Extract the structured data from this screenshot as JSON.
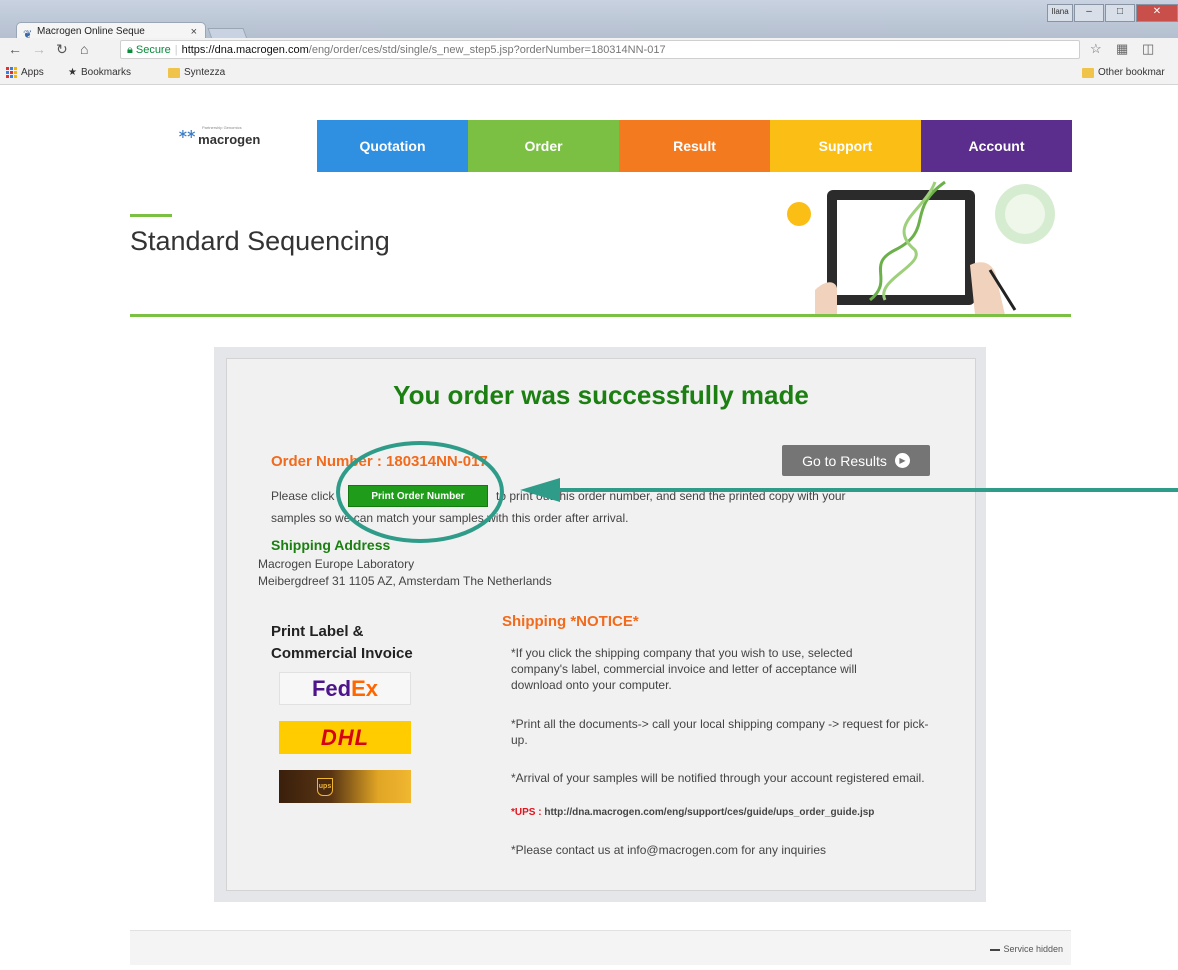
{
  "browser": {
    "tab_title": "Macrogen Online Seque",
    "tab_close": "×",
    "url_secure": "Secure",
    "url_host": "https://dna.macrogen.com",
    "url_path": "/eng/order/ces/std/single/s_new_step5.jsp?orderNumber=180314NN-017",
    "user_label": "Ilana",
    "bookmarks": {
      "apps": "Apps",
      "bookmarks": "Bookmarks",
      "syntezza": "Syntezza",
      "other": "Other bookmar"
    }
  },
  "site": {
    "logo_text": "macrogen",
    "logo_tagline": "Partnership Genomics",
    "nav": [
      "Quotation",
      "Order",
      "Result",
      "Support",
      "Account"
    ],
    "nav_colors": [
      "#2f8fe0",
      "#7bc043",
      "#f47a20",
      "#fbbe14",
      "#5b2d8c"
    ],
    "page_title": "Standard Sequencing"
  },
  "confirmation": {
    "title": "You order was successfully made",
    "order_number_label": "Order Number : 180314NN-017",
    "go_results": "Go to Results",
    "instr_before": "Please click",
    "print_button": "Print Order Number",
    "instr_after": "to print out this order number, and send the printed copy with your",
    "instr_line2": "samples so we can match your samples with this order after arrival.",
    "shipping_heading": "Shipping Address",
    "shipping_line1": "Macrogen Europe Laboratory",
    "shipping_line2": "Meibergdreef 31 1105 AZ, Amsterdam The Netherlands"
  },
  "labels": {
    "heading_line1": "Print Label &",
    "heading_line2": "Commercial Invoice",
    "carriers": {
      "fedex_fe": "Fed",
      "fedex_ex": "Ex",
      "dhl": "DHL",
      "ups": "ups"
    }
  },
  "notice": {
    "heading": "Shipping *NOTICE*",
    "item1": "*If you click the shipping company that you wish to use, selected company's label, commercial invoice and letter of acceptance will download onto your computer.",
    "item2": "*Print all the documents-> call your local shipping company -> request for pick-up.",
    "item3": "*Arrival of your samples will be notified through your account registered email.",
    "ups_prefix": "*UPS : ",
    "ups_url": "http://dna.macrogen.com/eng/support/ces/guide/ups_order_guide.jsp",
    "item4": "*Please contact us at info@macrogen.com for any inquiries"
  },
  "footer": {
    "service": "Service hidden"
  },
  "annotation": {
    "color": "#2f9c8a"
  }
}
